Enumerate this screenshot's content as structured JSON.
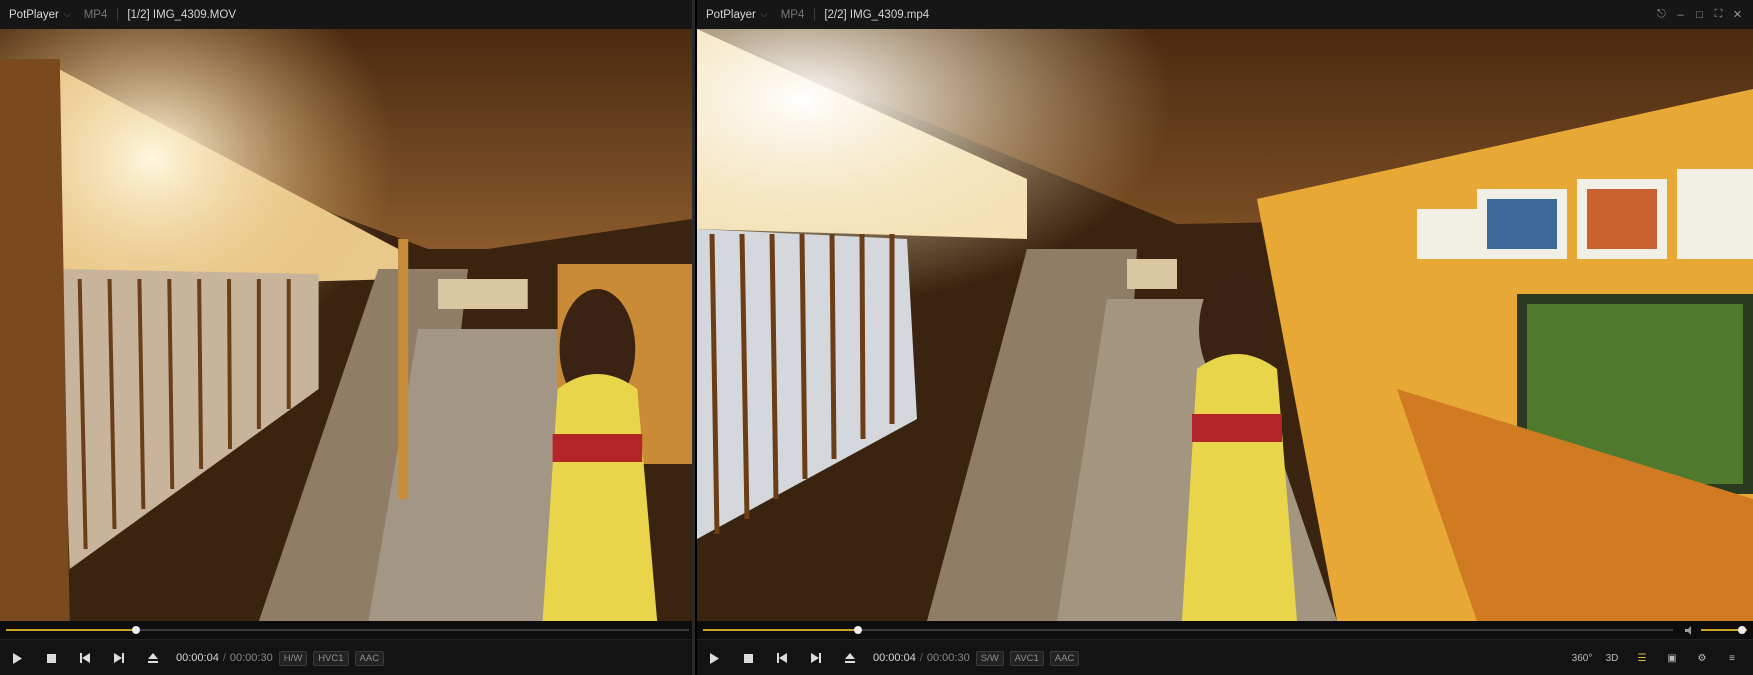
{
  "app_name": "PotPlayer",
  "colors": {
    "accent": "#c9a227",
    "background": "#101010",
    "titlebar": "#161616"
  },
  "left_window": {
    "brand": "PotPlayer",
    "format": "MP4",
    "filename": "[1/2] IMG_4309.MOV",
    "progress": 0.19,
    "time_current": "00:00:04",
    "time_separator": "/",
    "time_total": "00:00:30",
    "badges": [
      "H/W",
      "HVC1",
      "AAC"
    ]
  },
  "right_window": {
    "brand": "PotPlayer",
    "format": "MP4",
    "filename": "[2/2] IMG_4309.mp4",
    "progress": 0.16,
    "volume": 0.9,
    "time_current": "00:00:04",
    "time_separator": "/",
    "time_total": "00:00:30",
    "badges": [
      "S/W",
      "AVC1",
      "AAC"
    ],
    "right_controls": [
      "360°",
      "3D",
      "playlist-icon",
      "capture-icon",
      "settings-icon",
      "menu-icon"
    ],
    "right_control_labels": {
      "vr": "360°",
      "stereo": "3D"
    },
    "window_controls": [
      "pin-icon",
      "minimize-icon",
      "restore-icon",
      "fullscreen-icon",
      "close-icon"
    ]
  },
  "controls": [
    "play-icon",
    "stop-icon",
    "previous-icon",
    "next-icon",
    "eject-icon"
  ]
}
